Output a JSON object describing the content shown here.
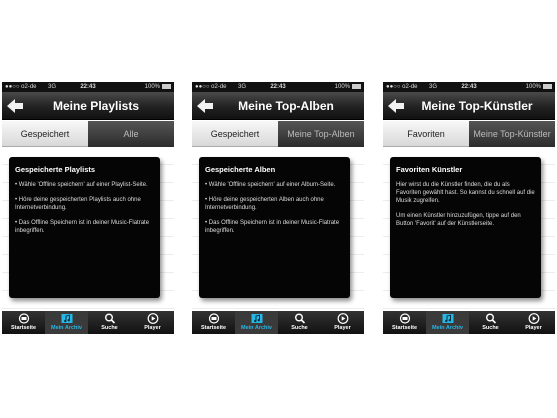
{
  "status": {
    "carrier": "●●○○ o2-de",
    "network": "3G",
    "time": "22:43",
    "battery": "100%"
  },
  "tabs": [
    {
      "label": "Startseite",
      "icon": "home-icon"
    },
    {
      "label": "Mein Archiv",
      "icon": "music-folder-icon",
      "active": true
    },
    {
      "label": "Suche",
      "icon": "search-icon"
    },
    {
      "label": "Player",
      "icon": "play-icon"
    }
  ],
  "screens": [
    {
      "title": "Meine Playlists",
      "segments": [
        "Gespeichert",
        "Alle"
      ],
      "box": {
        "heading": "Gespeicherte   Playlists",
        "lines": [
          "• Wähle 'Offline speichern' auf einer Playlist-Seite.",
          "• Höre deine gespeicherten Playlists auch ohne Internetverbindung.",
          "• Das Offline Speichern ist in deiner Music-Flatrate inbegriffen."
        ]
      }
    },
    {
      "title": "Meine Top-Alben",
      "segments": [
        "Gespeichert",
        "Meine Top-Alben"
      ],
      "box": {
        "heading": "Gespeicherte   Alben",
        "lines": [
          "• Wähle 'Offline speichern' auf einer Album-Seite.",
          "• Höre deine gespeicherten Alben auch ohne Internetverbindung.",
          "• Das Offline Speichern ist in deiner Music-Flatrate inbegriffen."
        ]
      }
    },
    {
      "title": "Meine Top-Künstler",
      "segments": [
        "Favoriten",
        "Meine Top-Künstler"
      ],
      "box": {
        "heading": "Favoriten Künstler",
        "lines": [
          "Hier wirst du die Künstler finden, die du als Favoriten gewählt hast. So kannst du schnell auf die Musik zugreifen.",
          "Um einen Künstler hinzuzufügen, tippe auf den Button 'Favorit' auf der Künstlerseite."
        ]
      }
    }
  ]
}
